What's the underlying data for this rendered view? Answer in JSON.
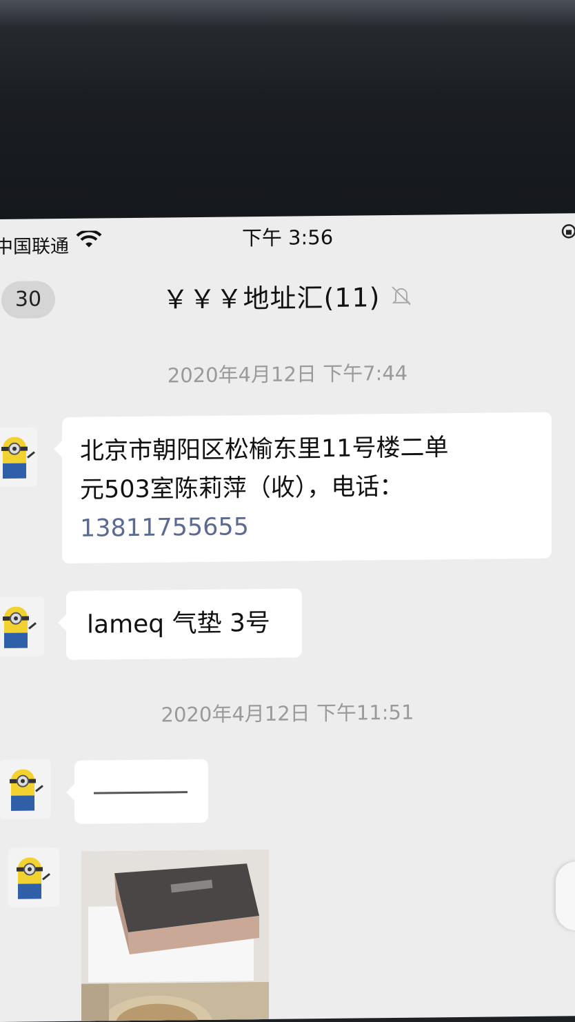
{
  "status_bar": {
    "carrier": "中国联通",
    "time": "下午 3:56"
  },
  "nav": {
    "back_count": "30",
    "title": "￥￥￥地址汇(11)"
  },
  "messages": [
    {
      "type": "timestamp",
      "text": "2020年4月12日 下午7:44"
    },
    {
      "type": "text",
      "lines": [
        "北京市朝阳区松榆东里11号楼二单",
        "元503室陈莉萍（收），电话："
      ],
      "phone": "13811755655"
    },
    {
      "type": "text",
      "text": "lameq 气垫 3号"
    },
    {
      "type": "timestamp",
      "text": "2020年4月12日 下午11:51"
    },
    {
      "type": "dash"
    },
    {
      "type": "image"
    }
  ],
  "colors": {
    "screen_bg": "#ededed",
    "bubble_bg": "#ffffff",
    "timestamp_text": "#9a9a9a",
    "phone_link": "#5a6a92",
    "avatar_yellow": "#f2d230",
    "avatar_blue": "#2f5fa8"
  },
  "icons": [
    "wifi-icon",
    "lock-icon",
    "mute-bell-icon",
    "minion-avatar"
  ]
}
